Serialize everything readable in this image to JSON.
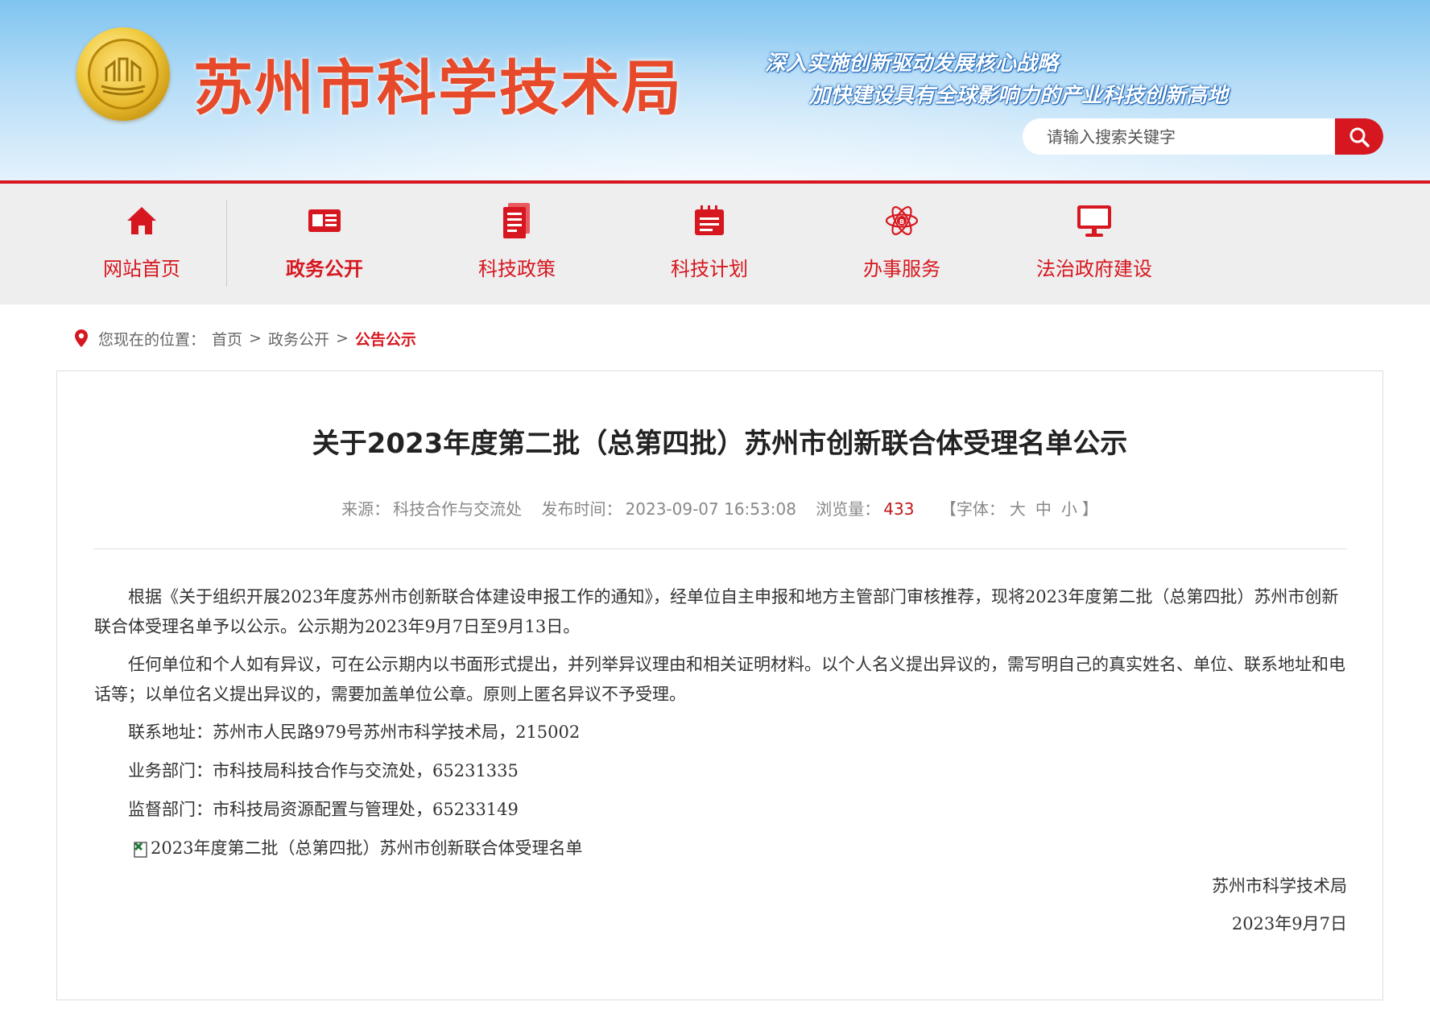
{
  "header": {
    "site_title": "苏州市科学技术局",
    "slogan_1": "深入实施创新驱动发展核心战略",
    "slogan_2": "加快建设具有全球影响力的产业科技创新高地",
    "search": {
      "placeholder": "请输入搜索关键字"
    },
    "colors": {
      "title": "#e64a2a",
      "accent": "#d7171f"
    }
  },
  "nav": {
    "items": [
      {
        "label": "网站首页",
        "icon": "home-icon"
      },
      {
        "label": "政务公开",
        "icon": "newspaper-icon",
        "active": true
      },
      {
        "label": "科技政策",
        "icon": "document-icon"
      },
      {
        "label": "科技计划",
        "icon": "calendar-icon"
      },
      {
        "label": "办事服务",
        "icon": "atom-icon"
      },
      {
        "label": "法治政府建设",
        "icon": "monitor-icon"
      }
    ]
  },
  "breadcrumb": {
    "prefix": "您现在的位置：",
    "items": [
      "首页",
      "政务公开",
      "公告公示"
    ],
    "sep": ">"
  },
  "article": {
    "title": "关于2023年度第二批（总第四批）苏州市创新联合体受理名单公示",
    "meta": {
      "source_label": "来源：",
      "source": "科技合作与交流处",
      "time_label": "发布时间：",
      "time": "2023-09-07 16:53:08",
      "views_label": "浏览量：",
      "views": "433",
      "font_open": "【字体：",
      "font_large": "大",
      "font_medium": "中",
      "font_small": "小",
      "font_close": "】"
    },
    "paragraphs": [
      "根据《关于组织开展2023年度苏州市创新联合体建设申报工作的通知》，经单位自主申报和地方主管部门审核推荐，现将2023年度第二批（总第四批）苏州市创新联合体受理名单予以公示。公示期为2023年9月7日至9月13日。",
      "任何单位和个人如有异议，可在公示期内以书面形式提出，并列举异议理由和相关证明材料。以个人名义提出异议的，需写明自己的真实姓名、单位、联系地址和电话等；以单位名义提出异议的，需要加盖单位公章。原则上匿名异议不予受理。",
      "联系地址：苏州市人民路979号苏州市科学技术局，215002",
      "业务部门：市科技局科技合作与交流处，65231335",
      "监督部门：市科技局资源配置与管理处，65233149"
    ],
    "attachment": "2023年度第二批（总第四批）苏州市创新联合体受理名单",
    "signature": "苏州市科学技术局",
    "date": "2023年9月7日"
  }
}
